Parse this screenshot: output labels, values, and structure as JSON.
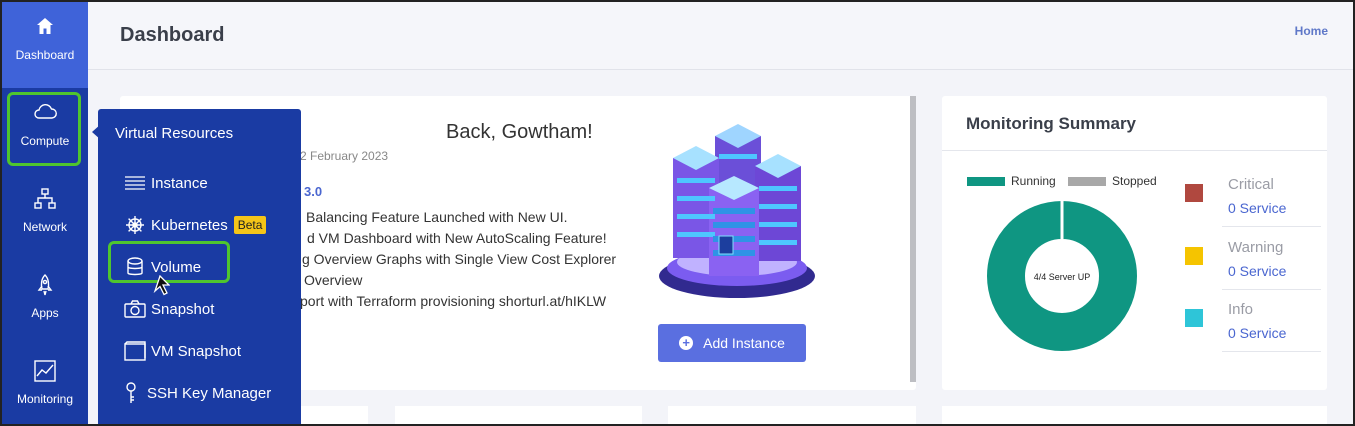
{
  "sidebar": {
    "items": [
      {
        "label": "Dashboard",
        "icon": "home-icon"
      },
      {
        "label": "Compute",
        "icon": "cloud-icon"
      },
      {
        "label": "Network",
        "icon": "network-icon"
      },
      {
        "label": "Apps",
        "icon": "rocket-icon"
      },
      {
        "label": "Monitoring",
        "icon": "chart-line-icon"
      }
    ]
  },
  "header": {
    "title": "Dashboard",
    "breadcrumb": "Home"
  },
  "welcome": {
    "title": "Back, Gowtham!",
    "date": "2 February 2023",
    "version": "3.0",
    "notes": [
      "Balancing Feature Launched with New UI.",
      "d VM Dashboard with New AutoScaling Feature!",
      "g Overview Graphs with Single View Cost Explorer",
      "Overview",
      "port with Terraform provisioning shorturl.at/hIKLW"
    ],
    "add_button": "Add Instance"
  },
  "monitoring": {
    "title": "Monitoring Summary",
    "legend": [
      {
        "label": "Running",
        "color": "#0f9682"
      },
      {
        "label": "Stopped",
        "color": "#a8a8a8"
      }
    ],
    "center_label": "4/4 Server UP",
    "statuses": [
      {
        "name": "Critical",
        "value": "0 Service",
        "color": "#b0483f"
      },
      {
        "name": "Warning",
        "value": "0 Service",
        "color": "#f5c400"
      },
      {
        "name": "Info",
        "value": "0 Service",
        "color": "#2ec5d8"
      }
    ]
  },
  "flyout": {
    "heading": "Virtual Resources",
    "items": [
      {
        "label": "Instance",
        "icon": "list-icon"
      },
      {
        "label": "Kubernetes",
        "icon": "helm-wheel-icon",
        "badge": "Beta"
      },
      {
        "label": "Volume",
        "icon": "database-icon"
      },
      {
        "label": "Snapshot",
        "icon": "camera-icon"
      },
      {
        "label": "VM Snapshot",
        "icon": "window-icon"
      },
      {
        "label": "SSH Key Manager",
        "icon": "key-icon"
      }
    ]
  },
  "colors": {
    "sidebar": "#1a3ba3",
    "sidebar_active": "#3f63d9",
    "accent": "#5a6fe0",
    "highlight": "#4fc52e"
  }
}
